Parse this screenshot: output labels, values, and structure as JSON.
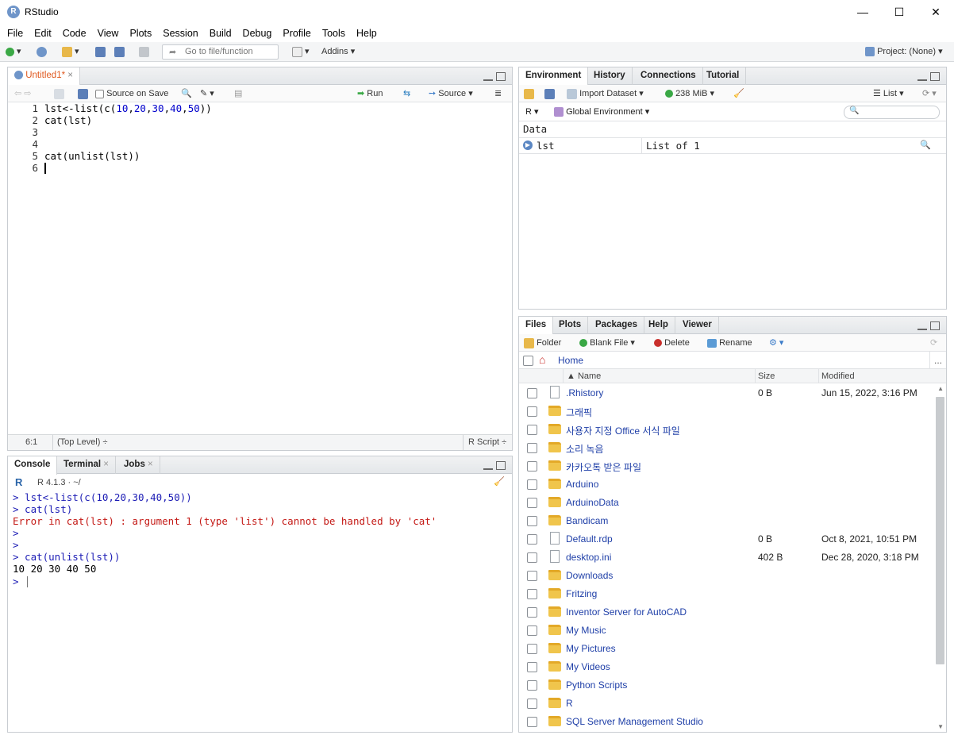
{
  "app": {
    "title": "RStudio",
    "icon_letter": "R"
  },
  "window": {
    "min": "—",
    "max": "☐",
    "close": "✕"
  },
  "menu": [
    "File",
    "Edit",
    "Code",
    "View",
    "Plots",
    "Session",
    "Build",
    "Debug",
    "Profile",
    "Tools",
    "Help"
  ],
  "toolbar": {
    "goto_placeholder": "Go to file/function",
    "addins": "Addins",
    "project": "Project: (None)"
  },
  "editor": {
    "tab_label": "Untitled1*",
    "source_on_save": "Source on Save",
    "run": "Run",
    "source": "Source",
    "line_numbers": [
      "1",
      "2",
      "3",
      "4",
      "5",
      "6"
    ],
    "status_pos": "6:1",
    "status_scope": "(Top Level) ÷",
    "status_type": "R Script ÷"
  },
  "console": {
    "tabs": [
      "Console",
      "Terminal",
      "Jobs"
    ],
    "version": "R 4.1.3 · ~/",
    "lines": [
      "> lst<-list(c(10,20,30,40,50))",
      "> cat(lst)",
      "Error in cat(lst) : argument 1 (type 'list') cannot be handled by 'cat'",
      ">",
      ">",
      "> cat(unlist(lst))",
      "10 20 30 40 50",
      "> "
    ]
  },
  "environment": {
    "tabs": [
      "Environment",
      "History",
      "Connections",
      "Tutorial"
    ],
    "import_dataset": "Import Dataset",
    "memory": "238 MiB",
    "list_view": "List",
    "r_label": "R",
    "global_env": "Global Environment",
    "section": "Data",
    "rows": [
      {
        "name": "lst",
        "value": "List of  1"
      }
    ]
  },
  "files": {
    "tabs": [
      "Files",
      "Plots",
      "Packages",
      "Help",
      "Viewer"
    ],
    "folder_btn": "Folder",
    "blank_file": "Blank File",
    "delete": "Delete",
    "rename": "Rename",
    "breadcrumb": "Home",
    "more": "...",
    "col_name": "▲ Name",
    "col_size": "Size",
    "col_modified": "Modified",
    "items": [
      {
        "name": ".Rhistory",
        "size": "0 B",
        "modified": "Jun 15, 2022, 3:16 PM",
        "kind": "doc"
      },
      {
        "name": "그래픽",
        "size": "",
        "modified": "",
        "kind": "folder"
      },
      {
        "name": "사용자 지정 Office 서식 파일",
        "size": "",
        "modified": "",
        "kind": "folder"
      },
      {
        "name": "소리 녹음",
        "size": "",
        "modified": "",
        "kind": "folder"
      },
      {
        "name": "카카오톡 받은 파일",
        "size": "",
        "modified": "",
        "kind": "folder"
      },
      {
        "name": "Arduino",
        "size": "",
        "modified": "",
        "kind": "folder"
      },
      {
        "name": "ArduinoData",
        "size": "",
        "modified": "",
        "kind": "folder"
      },
      {
        "name": "Bandicam",
        "size": "",
        "modified": "",
        "kind": "folder"
      },
      {
        "name": "Default.rdp",
        "size": "0 B",
        "modified": "Oct 8, 2021, 10:51 PM",
        "kind": "doc"
      },
      {
        "name": "desktop.ini",
        "size": "402 B",
        "modified": "Dec 28, 2020, 3:18 PM",
        "kind": "doc"
      },
      {
        "name": "Downloads",
        "size": "",
        "modified": "",
        "kind": "folder"
      },
      {
        "name": "Fritzing",
        "size": "",
        "modified": "",
        "kind": "folder"
      },
      {
        "name": "Inventor Server for AutoCAD",
        "size": "",
        "modified": "",
        "kind": "folder"
      },
      {
        "name": "My Music",
        "size": "",
        "modified": "",
        "kind": "folder"
      },
      {
        "name": "My Pictures",
        "size": "",
        "modified": "",
        "kind": "folder"
      },
      {
        "name": "My Videos",
        "size": "",
        "modified": "",
        "kind": "folder"
      },
      {
        "name": "Python Scripts",
        "size": "",
        "modified": "",
        "kind": "folder"
      },
      {
        "name": "R",
        "size": "",
        "modified": "",
        "kind": "folder"
      },
      {
        "name": "SQL Server Management Studio",
        "size": "",
        "modified": "",
        "kind": "folder"
      }
    ]
  }
}
